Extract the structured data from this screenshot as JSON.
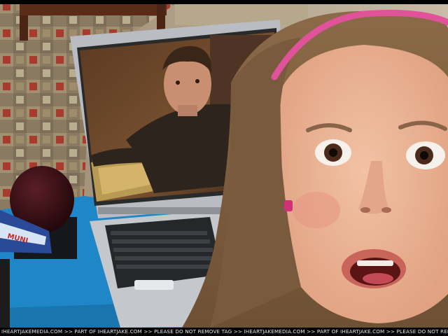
{
  "image": {
    "alt": "Girl with surprised expression next to laptop screen showing a man",
    "watermark": "IHEARTJAKEMEDIA.COM >> PART OF IHEARTJAKE.COM >> PLEASE DO NOT REMOVE TAG >> IHEARTJAKEMEDIA.COM >> PART OF IHEARTJAKE.COM >> PLEASE DO NOT REMOVE TAG",
    "mic_flag_text": "MUNI"
  },
  "colors": {
    "table_blue": "#1f86c7",
    "carpet_red": "#a83a2e",
    "laptop_silver": "#b9bcc2",
    "headband_pink": "#e0529a"
  }
}
